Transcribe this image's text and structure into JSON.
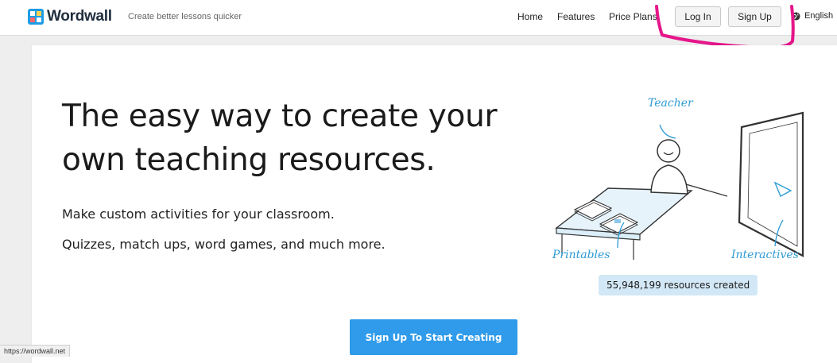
{
  "header": {
    "logo_text": "Wordwall",
    "tagline": "Create better lessons quicker",
    "nav": {
      "home": "Home",
      "features": "Features",
      "price_plans": "Price Plans"
    },
    "login_label": "Log In",
    "signup_label": "Sign Up",
    "language": "English"
  },
  "hero": {
    "headline_line1": "The easy way to create your",
    "headline_line2": "own teaching resources.",
    "sub1": "Make custom activities for your classroom.",
    "sub2": "Quizzes, match ups, word games, and much more.",
    "illustration": {
      "teacher": "Teacher",
      "printables": "Printables",
      "interactives": "Interactives"
    },
    "resources_badge": "55,948,199 resources created",
    "cta_label": "Sign Up To Start Creating"
  },
  "status_bar": {
    "url": "https://wordwall.net"
  },
  "colors": {
    "accent": "#2f9bea",
    "badge_bg": "#d3e8f6",
    "annotation": "#e5168a",
    "logo_blue": "#1d9ce5"
  },
  "icons": [
    "wordwall-logo-icon",
    "globe-icon"
  ]
}
